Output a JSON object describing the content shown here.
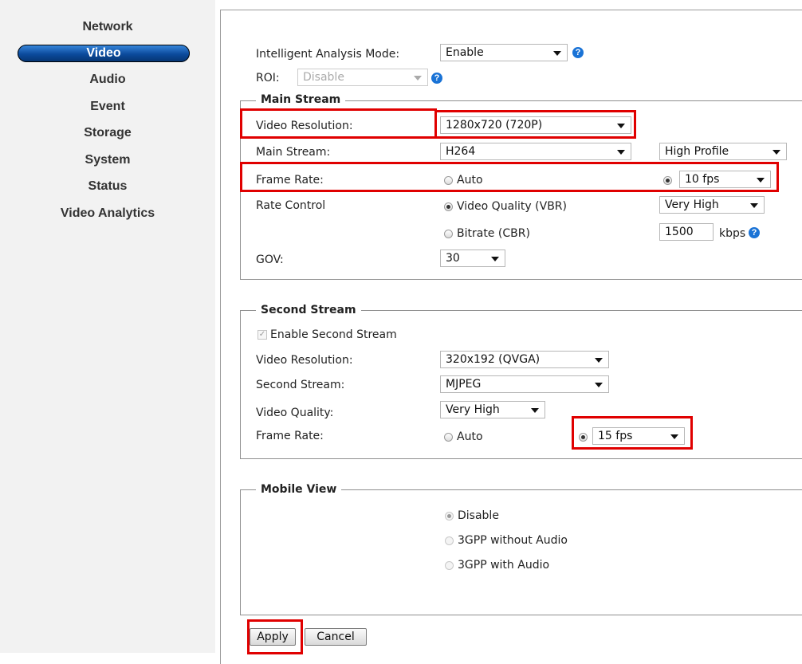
{
  "sidebar": {
    "items": [
      {
        "label": "Network"
      },
      {
        "label": "Video"
      },
      {
        "label": "Audio"
      },
      {
        "label": "Event"
      },
      {
        "label": "Storage"
      },
      {
        "label": "System"
      },
      {
        "label": "Status"
      },
      {
        "label": "Video Analytics"
      }
    ],
    "active": "Video"
  },
  "top": {
    "ia_mode_label": "Intelligent Analysis Mode:",
    "ia_mode_value": "Enable",
    "roi_label": "ROI:",
    "roi_value": "Disable",
    "help_glyph": "?"
  },
  "main_stream": {
    "legend": "Main Stream",
    "video_resolution_label": "Video Resolution:",
    "video_resolution_value": "1280x720 (720P)",
    "main_stream_label": "Main Stream:",
    "codec_value": "H264",
    "profile_value": "High Profile",
    "frame_rate_label": "Frame Rate:",
    "frame_rate_auto": "Auto",
    "frame_rate_value": "10 fps",
    "rate_control_label": "Rate Control",
    "vbr_label": "Video Quality (VBR)",
    "vbr_value": "Very High",
    "cbr_label": "Bitrate (CBR)",
    "bitrate_value": "1500",
    "bitrate_unit": "kbps",
    "gov_label": "GOV:",
    "gov_value": "30"
  },
  "second_stream": {
    "legend": "Second Stream",
    "enable_label": "Enable Second Stream",
    "video_resolution_label": "Video Resolution:",
    "video_resolution_value": "320x192 (QVGA)",
    "second_stream_label": "Second Stream:",
    "codec_value": "MJPEG",
    "video_quality_label": "Video Quality:",
    "video_quality_value": "Very High",
    "frame_rate_label": "Frame Rate:",
    "frame_rate_auto": "Auto",
    "frame_rate_value": "15 fps"
  },
  "mobile_view": {
    "legend": "Mobile View",
    "options": [
      "Disable",
      "3GPP without Audio",
      "3GPP with Audio"
    ]
  },
  "buttons": {
    "apply": "Apply",
    "cancel": "Cancel"
  },
  "colors": {
    "highlight": "#e00000",
    "active_nav": "#0b4a9c",
    "help_icon": "#1a73d6"
  }
}
